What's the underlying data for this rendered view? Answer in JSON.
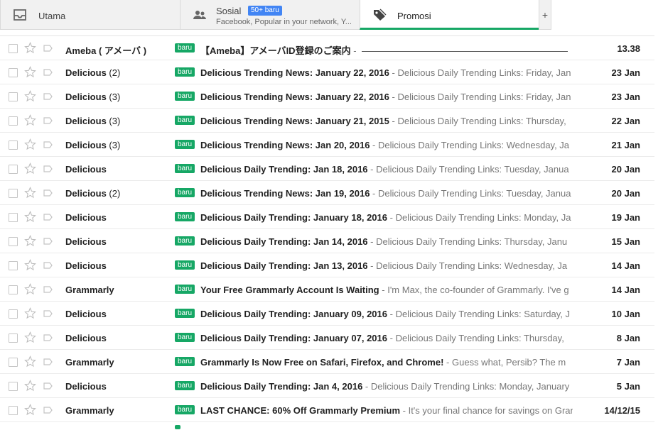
{
  "tabs": [
    {
      "name": "Utama",
      "icon": "inbox-icon",
      "active": false
    },
    {
      "name": "Sosial",
      "badge": "50+ baru",
      "subtitle": "Facebook, Popular in your network, Y...",
      "icon": "people-icon",
      "active": false
    },
    {
      "name": "Promosi",
      "icon": "tag-icon",
      "active": true
    }
  ],
  "add_tab_label": "+",
  "label_text": "baru",
  "colors": {
    "label": "#16a765",
    "badge": "#4285f4",
    "active_tab_border": "#16a765"
  },
  "emails": [
    {
      "sender": "Ameba ( アメーバ )",
      "count": "",
      "subject": "【Ameba】アメーバID登録のご案内",
      "preview": "",
      "date": "13.38",
      "ruler": true
    },
    {
      "sender": "Delicious",
      "count": "(2)",
      "subject": "Delicious Trending News: January 22, 2016",
      "preview": "Delicious Daily Trending Links: Friday, Jan",
      "date": "23 Jan"
    },
    {
      "sender": "Delicious",
      "count": "(3)",
      "subject": "Delicious Trending News: January 22, 2016",
      "preview": "Delicious Daily Trending Links: Friday, Jan",
      "date": "23 Jan"
    },
    {
      "sender": "Delicious",
      "count": "(3)",
      "subject": "Delicious Trending News: January 21, 2015",
      "preview": "Delicious Daily Trending Links: Thursday,",
      "date": "22 Jan"
    },
    {
      "sender": "Delicious",
      "count": "(3)",
      "subject": "Delicious Trending News: Jan 20, 2016",
      "preview": "Delicious Daily Trending Links: Wednesday, Ja",
      "date": "21 Jan"
    },
    {
      "sender": "Delicious",
      "count": "",
      "subject": "Delicious Daily Trending: Jan 18, 2016",
      "preview": "Delicious Daily Trending Links: Tuesday, Janua",
      "date": "20 Jan"
    },
    {
      "sender": "Delicious",
      "count": "(2)",
      "subject": "Delicious Trending News: Jan 19, 2016",
      "preview": "Delicious Daily Trending Links: Tuesday, Janua",
      "date": "20 Jan"
    },
    {
      "sender": "Delicious",
      "count": "",
      "subject": "Delicious Daily Trending: January 18, 2016",
      "preview": "Delicious Daily Trending Links: Monday, Ja",
      "date": "19 Jan"
    },
    {
      "sender": "Delicious",
      "count": "",
      "subject": "Delicious Daily Trending: Jan 14, 2016",
      "preview": "Delicious Daily Trending Links: Thursday, Janu",
      "date": "15 Jan"
    },
    {
      "sender": "Delicious",
      "count": "",
      "subject": "Delicious Daily Trending: Jan 13, 2016",
      "preview": "Delicious Daily Trending Links: Wednesday, Ja",
      "date": "14 Jan"
    },
    {
      "sender": "Grammarly",
      "count": "",
      "subject": "Your Free Grammarly Account Is Waiting",
      "preview": "I'm Max, the co-founder of Grammarly. I've g",
      "date": "14 Jan"
    },
    {
      "sender": "Delicious",
      "count": "",
      "subject": "Delicious Daily Trending: January 09, 2016",
      "preview": "Delicious Daily Trending Links: Saturday, J",
      "date": "10 Jan"
    },
    {
      "sender": "Delicious",
      "count": "",
      "subject": "Delicious Daily Trending: January 07, 2016",
      "preview": "Delicious Daily Trending Links: Thursday,",
      "date": "8 Jan"
    },
    {
      "sender": "Grammarly",
      "count": "",
      "subject": "Grammarly Is Now Free on Safari, Firefox, and Chrome!",
      "preview": "Guess what, Persib? The m",
      "date": "7 Jan"
    },
    {
      "sender": "Delicious",
      "count": "",
      "subject": "Delicious Daily Trending: Jan 4, 2016",
      "preview": "Delicious Daily Trending Links: Monday, January",
      "date": "5 Jan"
    },
    {
      "sender": "Grammarly",
      "count": "",
      "subject": "LAST CHANCE: 60% Off Grammarly Premium",
      "preview": "It's your final chance for savings on Gran",
      "date": "14/12/15"
    }
  ]
}
